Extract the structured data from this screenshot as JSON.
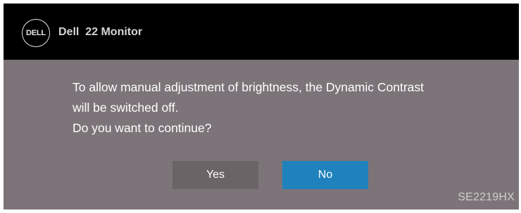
{
  "header": {
    "logo_text": "DELL",
    "title": "Dell  22 Monitor"
  },
  "dialog": {
    "lines": [
      "To allow manual adjustment of brightness, the Dynamic Contrast",
      "will be switched off.",
      "Do you want to continue?"
    ],
    "yes_label": "Yes",
    "no_label": "No",
    "selected": "No"
  },
  "footer": {
    "model": "SE2219HX"
  },
  "colors": {
    "header_bg": "#000000",
    "panel_bg": "#7c7478",
    "yes_bg": "#6b6467",
    "no_bg_selected": "#1f82bd"
  }
}
